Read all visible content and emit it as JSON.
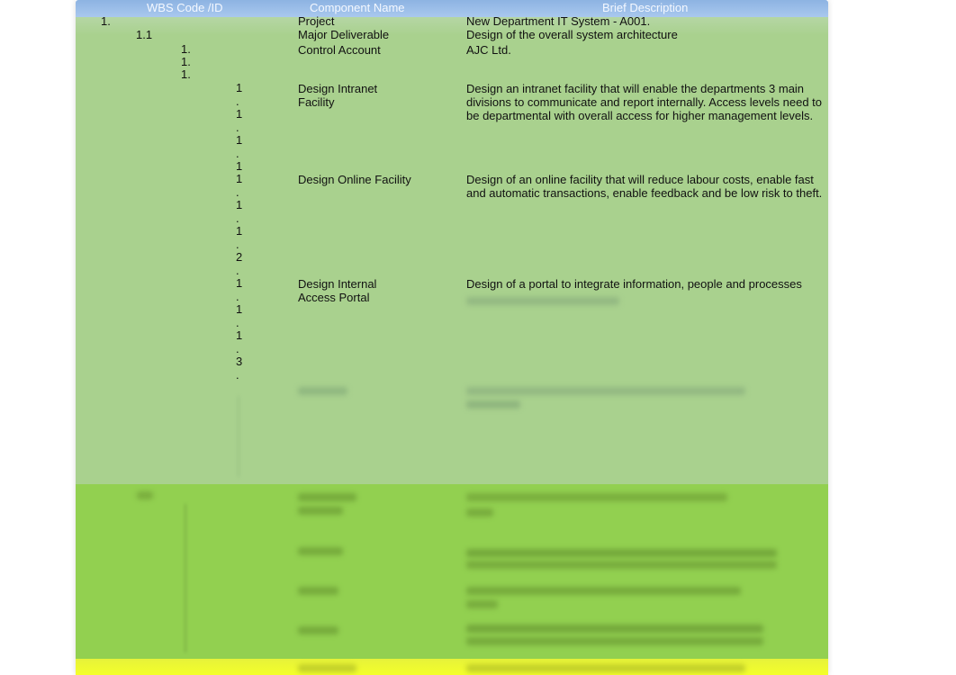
{
  "header": {
    "wbs": "WBS Code /ID",
    "component": "Component Name",
    "description": "Brief Description"
  },
  "rows": [
    {
      "code": "1.",
      "component": "Project",
      "description": "New Department IT System - A001."
    },
    {
      "code": "1.1",
      "component": "Major Deliverable",
      "description": "Design of the overall system architecture"
    },
    {
      "code": "1.\n1.\n1.",
      "component": "Control Account",
      "description": "AJC Ltd."
    },
    {
      "code": "1\n.\n1\n.\n1\n.\n1",
      "component": "Design Intranet\nFacility",
      "description": "Design an intranet facility that will enable the departments 3 main\ndivisions to communicate and report internally. Access levels need to\nbe departmental with overall access for higher management levels."
    },
    {
      "code": "1\n.\n1\n.\n1\n.\n2\n.",
      "component": "Design Online Facility",
      "description": "Design of an online facility that will reduce labour costs, enable fast\nand automatic transactions, enable feedback and be low risk to theft."
    },
    {
      "code": "1\n.\n1\n.\n1\n.\n3\n.",
      "component": "Design Internal\nAccess Portal",
      "description": "Design of a portal to integrate information, people and processes"
    }
  ],
  "colors": {
    "header": "#8db3e2",
    "light_green": "#a9d18e",
    "green": "#92d050",
    "yellow": "#f4ff2a"
  }
}
